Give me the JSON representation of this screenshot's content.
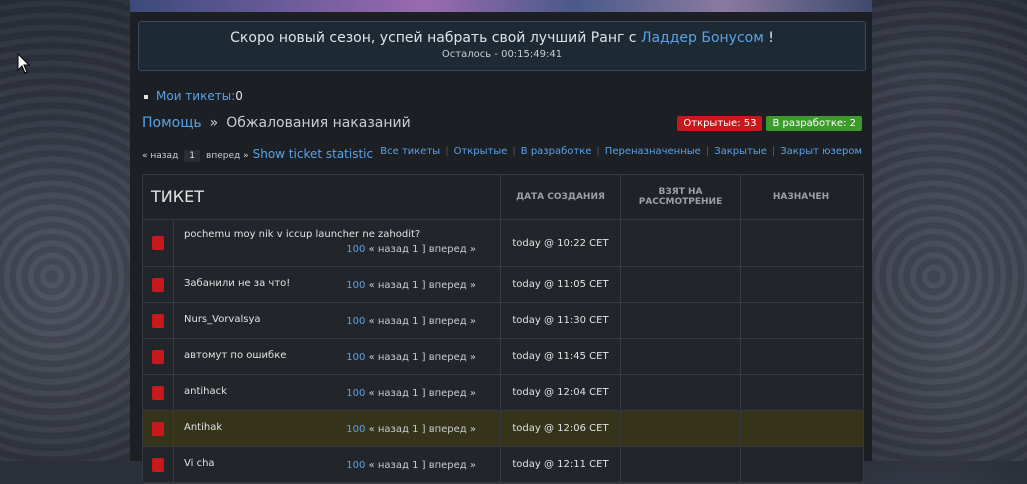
{
  "notice": {
    "text_before": "Скоро новый сезон, успей набрать свой лучший Ранг с ",
    "link": "Ладдер Бонусом",
    "text_after": " !",
    "countdown": "Осталось - 00:15:49:41"
  },
  "mytickets": {
    "label": "Мои тикеты:",
    "count": "0"
  },
  "breadcrumb": {
    "home": "Помощь",
    "sep": "»",
    "current": "Обжалования наказаний"
  },
  "badges": {
    "open": "Открытые: 53",
    "dev": "В разработке: 2"
  },
  "pager": {
    "prev": "« назад",
    "page": "1",
    "next": "вперед »",
    "stats": "Show ticket statistic"
  },
  "filters": [
    "Все тикеты",
    "Открытые",
    "В разработке",
    "Переназначенные",
    "Закрытые",
    "Закрыт юзером"
  ],
  "table": {
    "headers": {
      "ticket": "ТИКЕТ",
      "created": "ДАТА СОЗДАНИЯ",
      "taken": "ВЗЯТ НА РАССМОТРЕНИЕ",
      "assigned": "НАЗНАЧЕН"
    },
    "rows": [
      {
        "title": "pochemu moy nik v iccup launcher ne zahodit?",
        "num": "100",
        "nav": " « назад 1 ] вперед »",
        "date": "today @ 10:22 CET",
        "highlight": false
      },
      {
        "title": "Забанили не за что!",
        "num": "100",
        "nav": " « назад 1 ] вперед »",
        "date": "today @ 11:05 CET",
        "highlight": false
      },
      {
        "title": "Nurs_Vorvalsya",
        "num": "100",
        "nav": " « назад 1 ] вперед »",
        "date": "today @ 11:30 CET",
        "highlight": false
      },
      {
        "title": "автомут по ошибке",
        "num": "100",
        "nav": " « назад 1 ] вперед »",
        "date": "today @ 11:45 CET",
        "highlight": false
      },
      {
        "title": "antihack",
        "num": "100",
        "nav": " « назад 1 ] вперед »",
        "date": "today @ 12:04 CET",
        "highlight": false
      },
      {
        "title": "Antihak",
        "num": "100",
        "nav": " « назад 1 ] вперед »",
        "date": "today @ 12:06 CET",
        "highlight": true
      },
      {
        "title": "Vi cha",
        "num": "100",
        "nav": " « назад 1 ] вперед »",
        "date": "today @ 12:11 CET",
        "highlight": false
      }
    ]
  },
  "colors": {
    "accent": "#5aa2e8",
    "open_badge": "#c9181c",
    "dev_badge": "#3d9a2d",
    "highlight_row": "#35331a"
  }
}
